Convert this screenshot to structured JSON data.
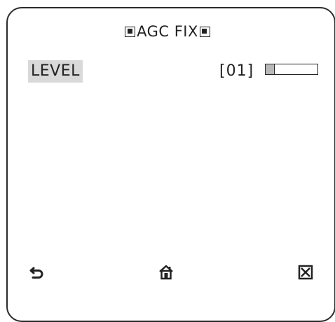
{
  "menu": {
    "title": "AGC FIX",
    "title_icons": [
      "filled-square-icon",
      "filled-square-icon"
    ]
  },
  "settings": {
    "level": {
      "label": "LEVEL",
      "value": "[01]",
      "bar_fraction": 0.18
    }
  },
  "footer": {
    "icons": [
      "back-arrow-icon",
      "home-icon",
      "close-box-icon"
    ]
  },
  "colors": {
    "frame": "#2a2a2a",
    "text": "#222222",
    "highlight": "#d9d9d9",
    "bar_fill": "#b8b8b8"
  }
}
